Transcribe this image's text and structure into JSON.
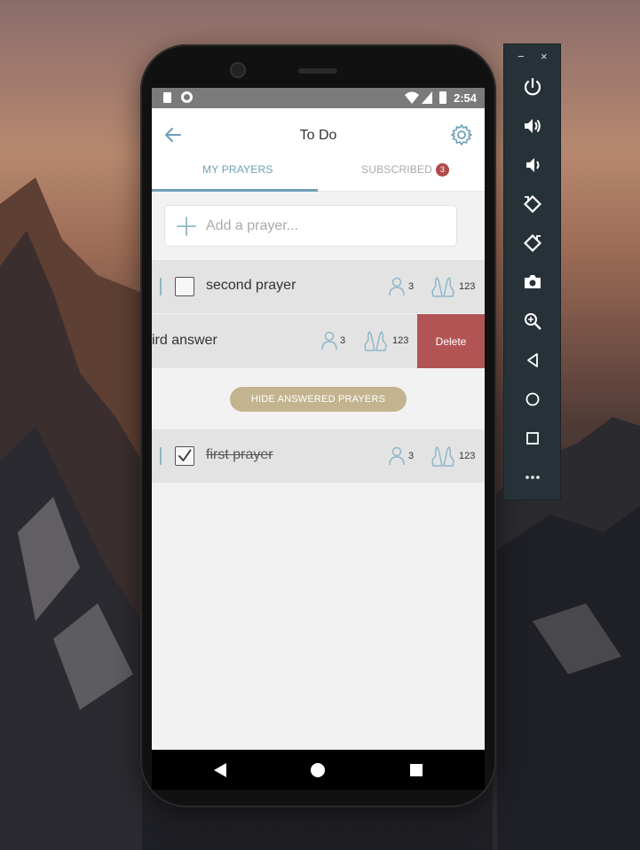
{
  "status_bar": {
    "time": "2:54"
  },
  "header": {
    "title": "To Do"
  },
  "tabs": [
    {
      "label": "MY PRAYERS",
      "active": true
    },
    {
      "label": "SUBSCRIBED",
      "badge": "3",
      "active": false
    }
  ],
  "add_prayer": {
    "placeholder": "Add a prayer...",
    "value": ""
  },
  "prayers": [
    {
      "label": "second prayer",
      "people": "3",
      "prays": "123",
      "checked": false
    },
    {
      "label": "ird answer",
      "people": "3",
      "prays": "123",
      "checked": false,
      "swiped": true,
      "delete_label": "Delete"
    },
    {
      "label": "first prayer",
      "people": "3",
      "prays": "123",
      "checked": true
    }
  ],
  "hide_answered_label": "HIDE ANSWERED PRAYERS",
  "emulator": {
    "minimize": "−",
    "close": "×",
    "tools": [
      "power-icon",
      "volume-up-icon",
      "volume-down-icon",
      "rotate-left-icon",
      "rotate-right-icon",
      "camera-icon",
      "zoom-icon",
      "back-icon",
      "home-icon",
      "overview-icon",
      "more-icon"
    ]
  },
  "colors": {
    "accent": "#6f9fb6",
    "delete": "#b35454",
    "hide_button": "#c3b48f",
    "badge": "#b04a4a"
  }
}
